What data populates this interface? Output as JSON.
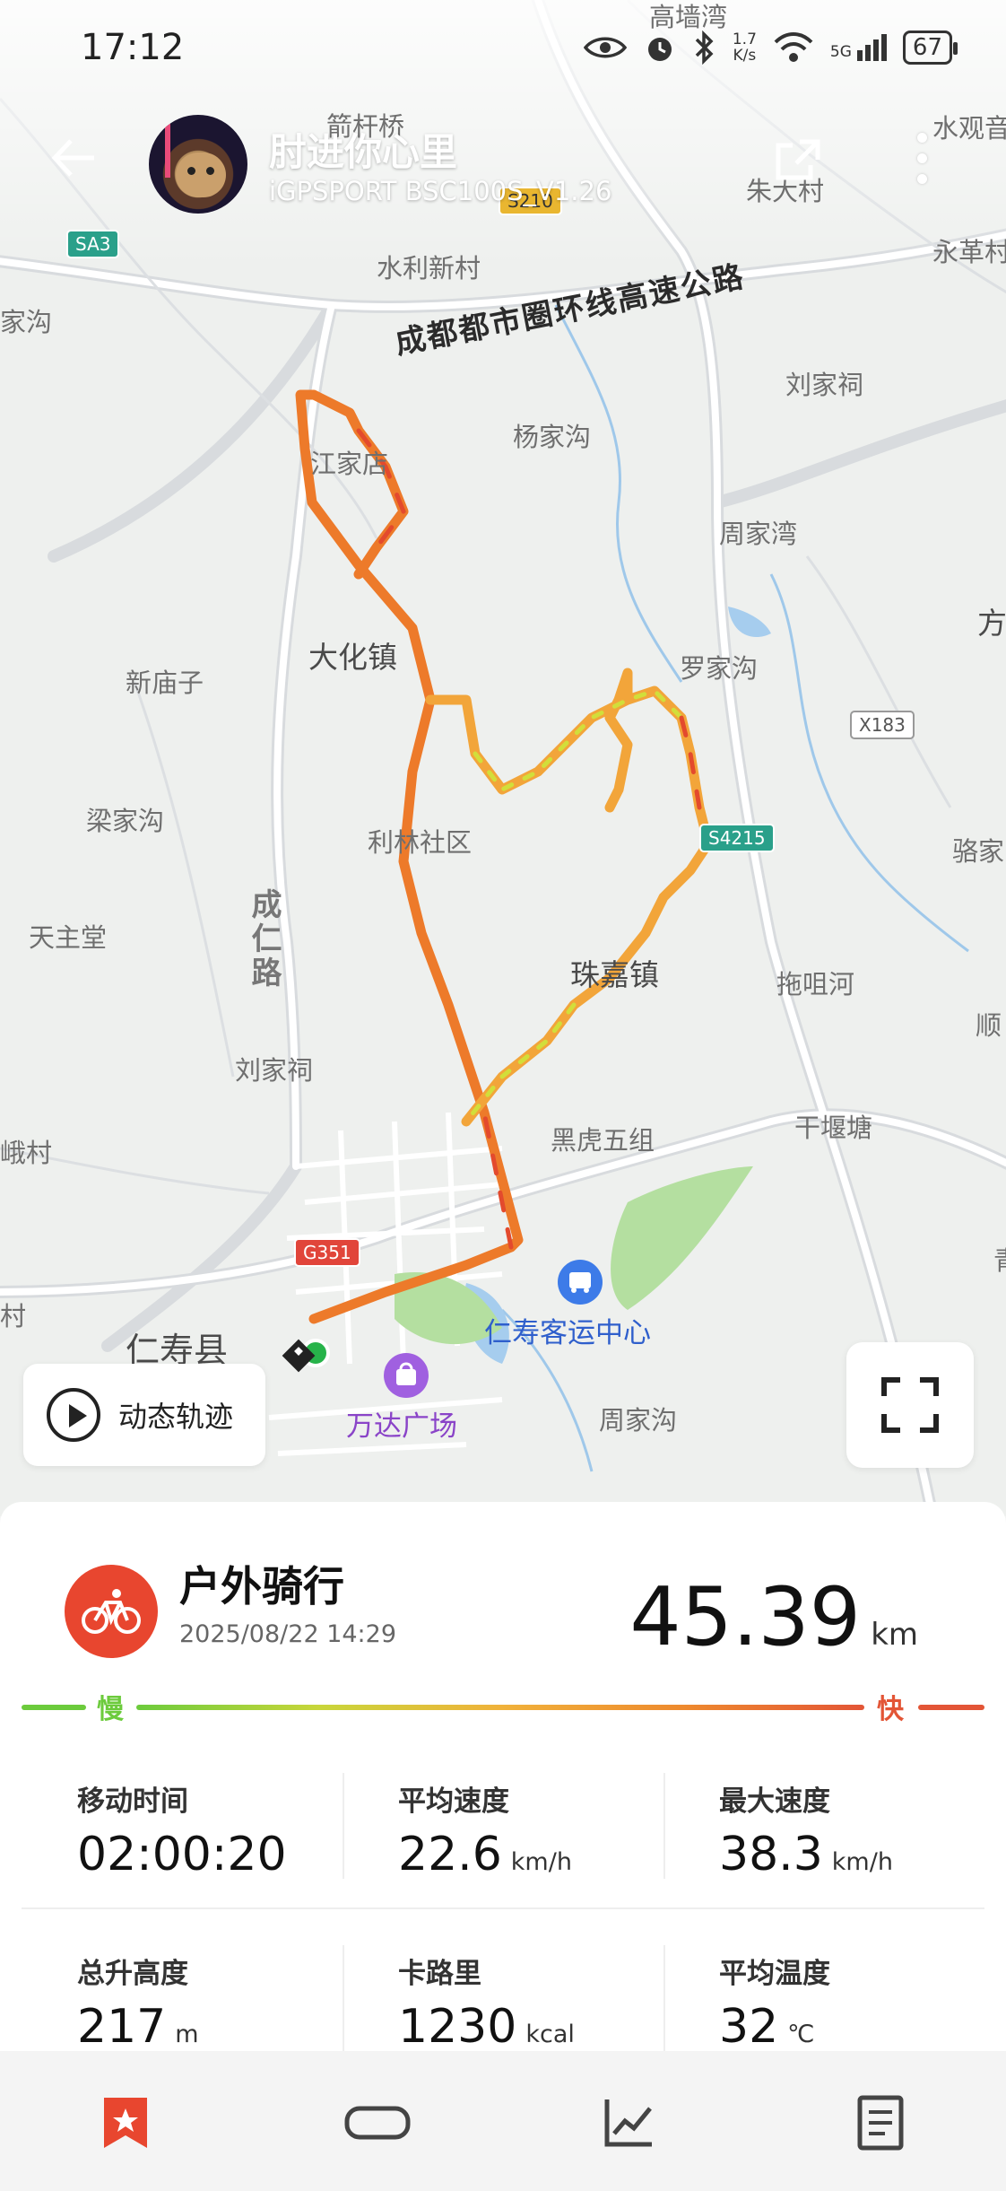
{
  "status_bar": {
    "time": "17:12",
    "net_speed_top": "1.7",
    "net_speed_bottom": "K/s",
    "network_badge": "5G",
    "battery": "67"
  },
  "header": {
    "user_name": "肘进你心里",
    "device": "iGPSPORT BSC100S_V1.26"
  },
  "map": {
    "places": [
      "高墙湾",
      "箭杆桥",
      "水观音",
      "朱大村",
      "永革村",
      "水利新村",
      "家沟",
      "刘家祠",
      "杨家沟",
      "江家店",
      "周家湾",
      "大化镇",
      "新庙子",
      "罗家沟",
      "方",
      "梁家沟",
      "利林社区",
      "骆家",
      "天主堂",
      "珠嘉镇",
      "拖咀河",
      "顺",
      "刘家祠",
      "黑虎五组",
      "干堰塘",
      "峨村",
      "村",
      "仁寿县",
      "周家沟",
      "青"
    ],
    "highway_label": "成都都市圈环线高速公路",
    "vertical_road_label": "成仁路",
    "road_tags": [
      "SA3",
      "S210",
      "X183",
      "S4215",
      "G351"
    ],
    "poi_bus": "仁寿客运中心",
    "poi_mall": "万达广场",
    "dynamic_track_button": "动态轨迹"
  },
  "activity": {
    "title": "户外骑行",
    "datetime": "2025/08/22 14:29",
    "distance": "45.39",
    "distance_unit": "km",
    "speed_legend_slow": "慢",
    "speed_legend_fast": "快",
    "stats": [
      {
        "label": "移动时间",
        "value": "02:00:20",
        "unit": ""
      },
      {
        "label": "平均速度",
        "value": "22.6",
        "unit": "km/h"
      },
      {
        "label": "最大速度",
        "value": "38.3",
        "unit": "km/h"
      },
      {
        "label": "总升高度",
        "value": "217",
        "unit": "m"
      },
      {
        "label": "卡路里",
        "value": "1230",
        "unit": "kcal"
      },
      {
        "label": "平均温度",
        "value": "32",
        "unit": "℃"
      }
    ]
  },
  "colors": {
    "accent_red": "#e8462f",
    "speed_slow": "#6ccb3c",
    "speed_fast": "#e35536",
    "route_orange": "#f08a2a"
  },
  "tabs": [
    "summary-tab",
    "device-tab",
    "chart-tab",
    "detail-tab"
  ]
}
